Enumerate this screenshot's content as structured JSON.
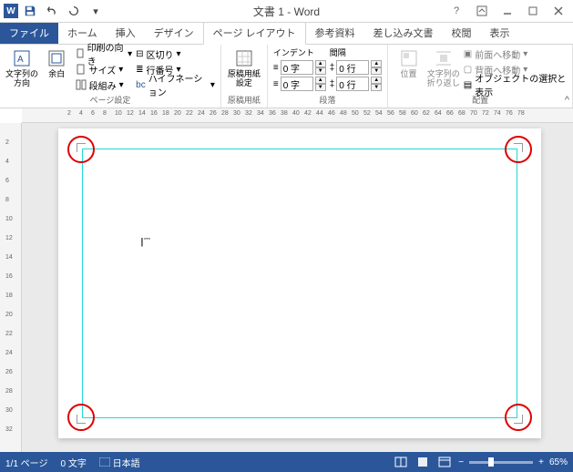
{
  "title": "文書 1 - Word",
  "app_letter": "W",
  "tabs": {
    "file": "ファイル",
    "home": "ホーム",
    "insert": "挿入",
    "design": "デザイン",
    "page_layout": "ページ レイアウト",
    "references": "参考資料",
    "mailings": "差し込み文書",
    "review": "校閲",
    "view": "表示"
  },
  "ribbon": {
    "page_setup": {
      "text_dir": "文字列の\n方向",
      "margins": "余白",
      "orientation": "印刷の向き",
      "size": "サイズ",
      "columns": "段組み",
      "breaks": "区切り",
      "line_numbers": "行番号",
      "hyphenation": "ハイフネーション",
      "label": "ページ設定"
    },
    "manuscript": {
      "btn": "原稿用紙\n設定",
      "label": "原稿用紙"
    },
    "paragraph": {
      "indent": "インデント",
      "spacing": "間隔",
      "left_val": "0 字",
      "right_val": "0 字",
      "before_val": "0 行",
      "after_val": "0 行",
      "label": "段落"
    },
    "arrange": {
      "position": "位置",
      "wrap": "文字列の\n折り返し",
      "bring_fwd": "前面へ移動",
      "send_back": "背面へ移動",
      "select_pane": "オブジェクトの選択と表示",
      "label": "配置"
    }
  },
  "ruler_h": [
    "2",
    "4",
    "6",
    "8",
    "10",
    "12",
    "14",
    "16",
    "18",
    "20",
    "22",
    "24",
    "26",
    "28",
    "30",
    "32",
    "34",
    "36",
    "38",
    "40",
    "42",
    "44",
    "46",
    "48",
    "50",
    "52",
    "54",
    "56",
    "58",
    "60",
    "62",
    "64",
    "66",
    "68",
    "70",
    "72",
    "74",
    "76",
    "78"
  ],
  "ruler_v": [
    "2",
    "4",
    "6",
    "8",
    "10",
    "12",
    "14",
    "16",
    "18",
    "20",
    "22",
    "24",
    "26",
    "28",
    "30",
    "32"
  ],
  "status": {
    "page": "1/1 ページ",
    "words": "0 文字",
    "lang": "日本語",
    "zoom": "65%"
  }
}
